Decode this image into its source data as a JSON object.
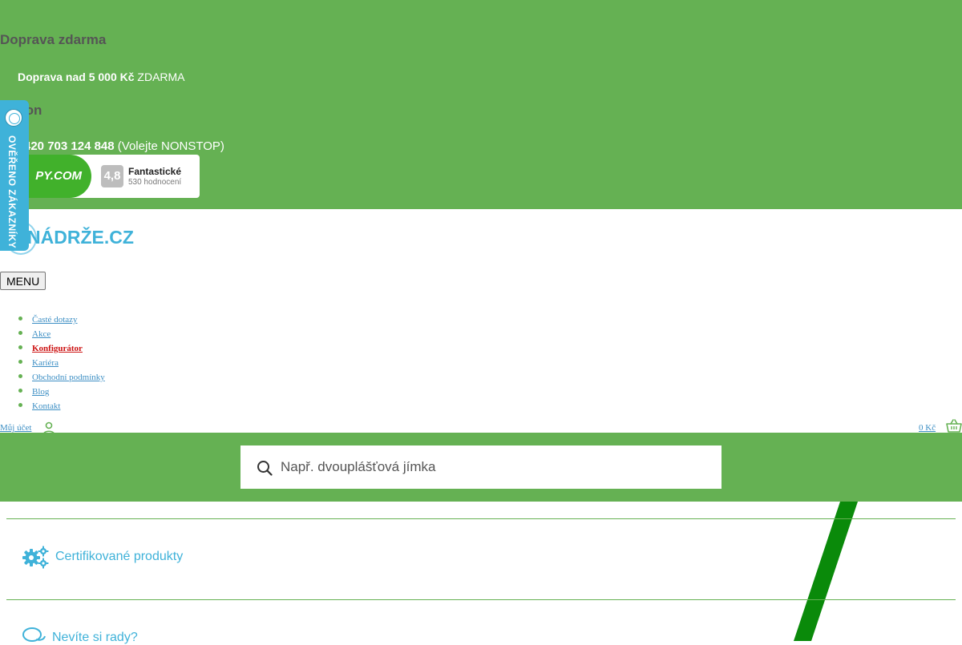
{
  "topbar": {
    "shipping_heading": "Doprava zdarma",
    "shipping_bold": "Doprava nad 5 000 Kč",
    "shipping_rest": " ZDARMA",
    "phone_heading": "fon",
    "phone_number": "420 703 124 848",
    "phone_note": " (Volejte NONSTOP)"
  },
  "rating": {
    "logo_text": "PY.COM",
    "score": "4,8",
    "label": "Fantastické",
    "count": "530 hodnocení"
  },
  "verified_tab": {
    "text": "OVĚŘENO ZÁKAZNÍKY"
  },
  "logo": {
    "text": "NÁDRŽE.CZ"
  },
  "menu": {
    "label": "MENU",
    "items": [
      {
        "label": "Časté dotazy"
      },
      {
        "label": "Akce"
      },
      {
        "label": "Konfigurátor"
      },
      {
        "label": "Kariéra"
      },
      {
        "label": "Obchodní podmínky"
      },
      {
        "label": "Blog"
      },
      {
        "label": "Kontakt"
      }
    ]
  },
  "account": {
    "label": "Můj účet"
  },
  "cart": {
    "price": "0 Kč"
  },
  "search": {
    "placeholder": "Např. dvouplášťová jímka"
  },
  "features": {
    "certified": "Certifikované produkty",
    "advice": "Nevíte si rady?"
  },
  "colors": {
    "brand_green": "#65b153",
    "brand_blue": "#3fb2d9",
    "active_red": "#cc1111"
  }
}
